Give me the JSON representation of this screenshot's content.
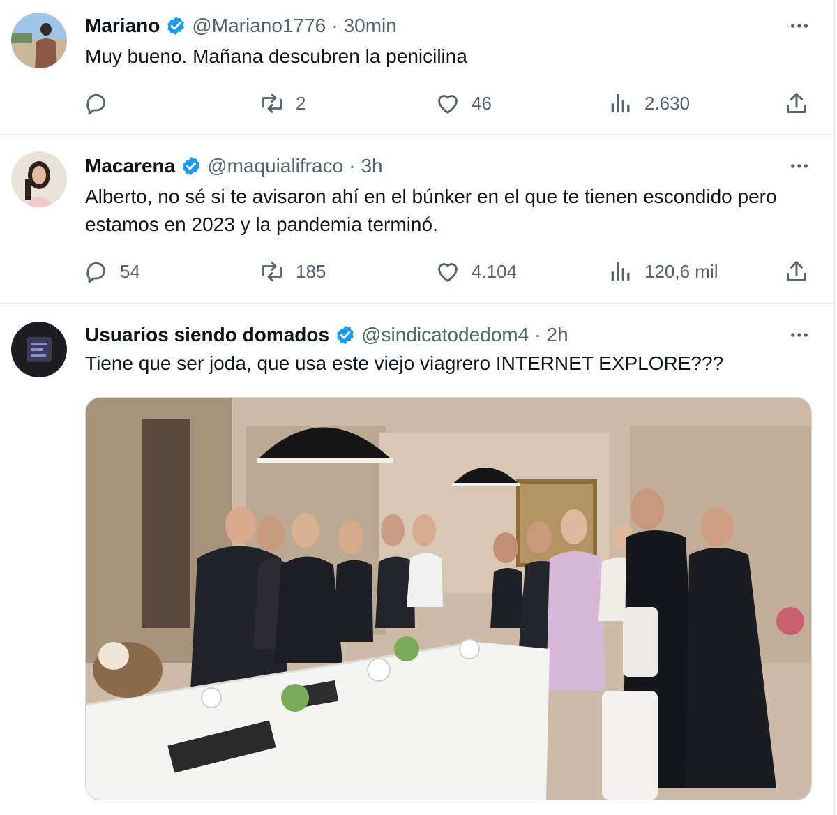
{
  "colors": {
    "text": "#0f1419",
    "secondary": "#536471",
    "verified": "#1d9bf0",
    "divider": "#e6e9ec"
  },
  "tweets": [
    {
      "name": "Mariano",
      "handle": "@Mariano1776",
      "separator": "·",
      "time": "30min",
      "text": "Muy bueno. Mañana descubren la penicilina",
      "replies": "",
      "retweets": "2",
      "likes": "46",
      "views": "2.630"
    },
    {
      "name": "Macarena",
      "handle": "@maquialifraco",
      "separator": "·",
      "time": "3h",
      "text": "Alberto, no sé si te avisaron ahí en el búnker en el que te tienen escondido pero estamos en 2023 y la pandemia terminó.",
      "replies": "54",
      "retweets": "185",
      "likes": "4.104",
      "views": "120,6 mil"
    },
    {
      "name": "Usuarios siendo domados",
      "handle": "@sindicatodedom4",
      "separator": "·",
      "time": "2h",
      "text": "Tiene que ser joda, que usa este viejo viagrero INTERNET EXPLORE???"
    }
  ],
  "icons": {
    "verified": "verified-badge-icon",
    "more": "more-options-icon",
    "reply": "reply-icon",
    "retweet": "retweet-icon",
    "like": "heart-icon",
    "views": "views-chart-icon",
    "share": "share-icon"
  }
}
